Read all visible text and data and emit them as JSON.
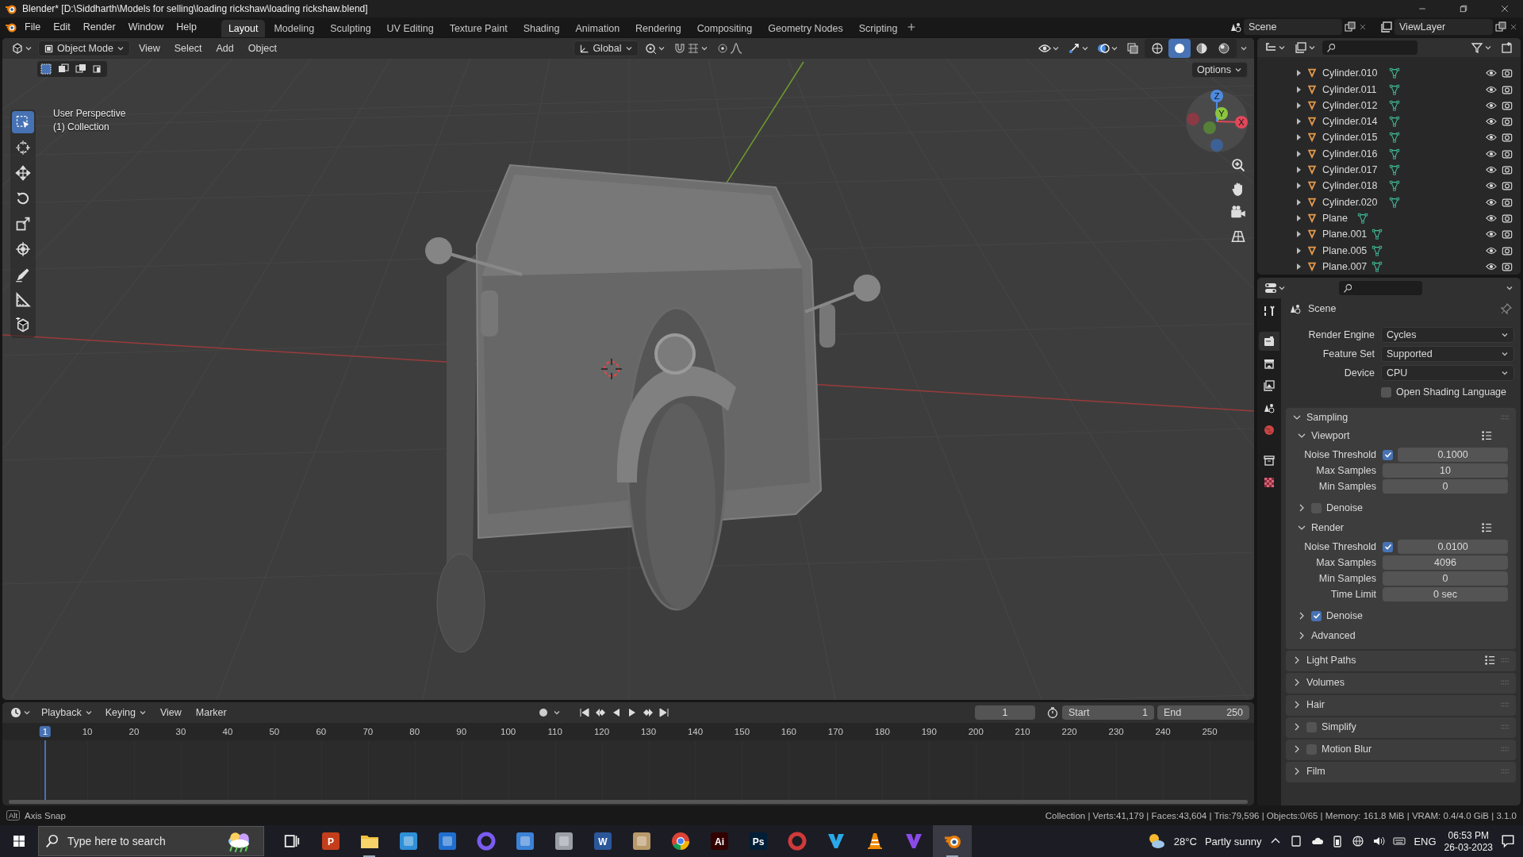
{
  "window": {
    "title": "Blender* [D:\\Siddharth\\Models for selling\\loading rickshaw\\loading rickshaw.blend]"
  },
  "menus": [
    "File",
    "Edit",
    "Render",
    "Window",
    "Help"
  ],
  "workspaces": [
    {
      "label": "Layout",
      "selected": true
    },
    {
      "label": "Modeling",
      "selected": false
    },
    {
      "label": "Sculpting",
      "selected": false
    },
    {
      "label": "UV Editing",
      "selected": false
    },
    {
      "label": "Texture Paint",
      "selected": false
    },
    {
      "label": "Shading",
      "selected": false
    },
    {
      "label": "Animation",
      "selected": false
    },
    {
      "label": "Rendering",
      "selected": false
    },
    {
      "label": "Compositing",
      "selected": false
    },
    {
      "label": "Geometry Nodes",
      "selected": false
    },
    {
      "label": "Scripting",
      "selected": false
    }
  ],
  "scene": "Scene",
  "view_layer": "ViewLayer",
  "viewport": {
    "mode": "Object Mode",
    "menus": [
      "View",
      "Select",
      "Add",
      "Object"
    ],
    "orientation": "Global",
    "options": "Options",
    "info": [
      "User Perspective",
      "(1) Collection"
    ],
    "tools": [
      {
        "kind": "select",
        "selected": true
      },
      {
        "kind": "cursor",
        "selected": false
      },
      {
        "kind": "move",
        "selected": false
      },
      {
        "kind": "rotate",
        "selected": false
      },
      {
        "kind": "scale",
        "selected": false
      },
      {
        "kind": "transform",
        "selected": false
      },
      {
        "kind": "annotate",
        "selected": false
      },
      {
        "kind": "measure",
        "selected": false
      },
      {
        "kind": "add-cube",
        "selected": false
      }
    ],
    "shading": [
      {
        "kind": "wireframe",
        "selected": false
      },
      {
        "kind": "solid",
        "selected": true
      },
      {
        "kind": "material",
        "selected": false
      },
      {
        "kind": "rendered",
        "selected": false
      }
    ],
    "gizmo": {
      "x": "X",
      "y": "Y",
      "z": "Z"
    }
  },
  "outliner": {
    "items": [
      {
        "name": "Cylinder.010"
      },
      {
        "name": "Cylinder.011"
      },
      {
        "name": "Cylinder.012"
      },
      {
        "name": "Cylinder.014"
      },
      {
        "name": "Cylinder.015"
      },
      {
        "name": "Cylinder.016"
      },
      {
        "name": "Cylinder.017"
      },
      {
        "name": "Cylinder.018"
      },
      {
        "name": "Cylinder.020"
      },
      {
        "name": "Plane"
      },
      {
        "name": "Plane.001"
      },
      {
        "name": "Plane.005"
      },
      {
        "name": "Plane.007"
      }
    ]
  },
  "properties": {
    "tabs": [
      {
        "kind": "tool",
        "selected": false
      },
      {
        "kind": "render",
        "selected": true
      },
      {
        "kind": "output",
        "selected": false
      },
      {
        "kind": "view-layer",
        "selected": false
      },
      {
        "kind": "scene",
        "selected": false
      },
      {
        "kind": "world",
        "selected": false
      },
      {
        "kind": "collection",
        "selected": false
      },
      {
        "kind": "texture",
        "selected": false
      }
    ],
    "context": "Scene",
    "fields": [
      {
        "label": "Render Engine",
        "value": "Cycles"
      },
      {
        "label": "Feature Set",
        "value": "Supported"
      },
      {
        "label": "Device",
        "value": "CPU"
      }
    ],
    "osl": {
      "label": "Open Shading Language",
      "checked": false
    },
    "sampling": {
      "title": "Sampling",
      "expanded": true,
      "subpanels": [
        {
          "title": "Viewport",
          "expanded": true,
          "noise": {
            "label": "Noise Threshold",
            "checked": true,
            "value": "0.1000"
          },
          "rows": [
            {
              "label": "Max Samples",
              "value": "10"
            },
            {
              "label": "Min Samples",
              "value": "0"
            }
          ],
          "denoise": {
            "label": "Denoise",
            "checked": false
          }
        },
        {
          "title": "Render",
          "expanded": true,
          "noise": {
            "label": "Noise Threshold",
            "checked": true,
            "value": "0.0100"
          },
          "rows": [
            {
              "label": "Max Samples",
              "value": "4096"
            },
            {
              "label": "Min Samples",
              "value": "0"
            },
            {
              "label": "Time Limit",
              "value": "0 sec"
            }
          ],
          "denoise": {
            "label": "Denoise",
            "checked": true
          }
        }
      ],
      "advanced": "Advanced"
    },
    "panels": [
      {
        "title": "Light Paths",
        "kind": "presets",
        "expanded": false
      },
      {
        "title": "Volumes",
        "kind": "plain",
        "expanded": false
      },
      {
        "title": "Hair",
        "kind": "plain",
        "expanded": false
      },
      {
        "title": "Simplify",
        "kind": "toggle",
        "checked": false,
        "expanded": false
      },
      {
        "title": "Motion Blur",
        "kind": "toggle",
        "checked": false,
        "expanded": false
      },
      {
        "title": "Film",
        "kind": "plain",
        "expanded": false
      }
    ]
  },
  "timeline": {
    "menus": [
      {
        "label": "Playback",
        "kind": "dropdown"
      },
      {
        "label": "Keying",
        "kind": "dropdown"
      },
      {
        "label": "View",
        "kind": "menu"
      },
      {
        "label": "Marker",
        "kind": "menu"
      }
    ],
    "current_frame": "1",
    "start_label": "Start",
    "start": "1",
    "end_label": "End",
    "end": "250",
    "ruler": [
      {
        "label": "1",
        "selected": true
      },
      {
        "label": "10",
        "selected": false
      },
      {
        "label": "20",
        "selected": false
      },
      {
        "label": "30",
        "selected": false
      },
      {
        "label": "40",
        "selected": false
      },
      {
        "label": "50",
        "selected": false
      },
      {
        "label": "60",
        "selected": false
      },
      {
        "label": "70",
        "selected": false
      },
      {
        "label": "80",
        "selected": false
      },
      {
        "label": "90",
        "selected": false
      },
      {
        "label": "100",
        "selected": false
      },
      {
        "label": "110",
        "selected": false
      },
      {
        "label": "120",
        "selected": false
      },
      {
        "label": "130",
        "selected": false
      },
      {
        "label": "140",
        "selected": false
      },
      {
        "label": "150",
        "selected": false
      },
      {
        "label": "160",
        "selected": false
      },
      {
        "label": "170",
        "selected": false
      },
      {
        "label": "180",
        "selected": false
      },
      {
        "label": "190",
        "selected": false
      },
      {
        "label": "200",
        "selected": false
      },
      {
        "label": "210",
        "selected": false
      },
      {
        "label": "220",
        "selected": false
      },
      {
        "label": "230",
        "selected": false
      },
      {
        "label": "240",
        "selected": false
      },
      {
        "label": "250",
        "selected": false
      }
    ]
  },
  "status_bar": {
    "key": "Alt",
    "hint": "Axis Snap",
    "stats": "Collection | Verts:41,179 | Faces:43,604 | Tris:79,596 | Objects:0/65 | Memory: 161.8 MiB | VRAM: 0.4/4.0 GiB | 3.1.0"
  },
  "taskbar": {
    "search_placeholder": "Type here to search",
    "apps": [
      {
        "kind": "task-view",
        "selected": false,
        "running": false
      },
      {
        "kind": "tile",
        "color": "#c43e1c",
        "label": "P",
        "selected": false,
        "running": false
      },
      {
        "kind": "folder",
        "selected": false,
        "running": true
      },
      {
        "kind": "tile",
        "color": "#2f8fd8",
        "selected": false,
        "running": false
      },
      {
        "kind": "tile",
        "color": "#1f6fd0",
        "selected": false,
        "running": false
      },
      {
        "kind": "ring",
        "color": "#7a5cf0",
        "selected": false,
        "running": false
      },
      {
        "kind": "tile",
        "color": "#3b82d6",
        "selected": false,
        "running": false
      },
      {
        "kind": "tile",
        "color": "#9aa0a6",
        "selected": false,
        "running": false
      },
      {
        "kind": "tile",
        "color": "#2b579a",
        "label": "W",
        "selected": false,
        "running": false
      },
      {
        "kind": "tile",
        "color": "#b89a6a",
        "selected": false,
        "running": false
      },
      {
        "kind": "chrome",
        "selected": false,
        "running": false
      },
      {
        "kind": "tile",
        "color": "#330000",
        "label": "Ai",
        "selected": false,
        "running": false
      },
      {
        "kind": "tile",
        "color": "#001e36",
        "label": "Ps",
        "selected": false,
        "running": false
      },
      {
        "kind": "ring",
        "color": "#d03a3a",
        "selected": false,
        "running": false
      },
      {
        "kind": "vee",
        "color": "#2aa8e8",
        "selected": false,
        "running": false
      },
      {
        "kind": "cone",
        "selected": false,
        "running": false
      },
      {
        "kind": "vee",
        "color": "#8a4be8",
        "selected": false,
        "running": false
      },
      {
        "kind": "blender",
        "selected": true,
        "running": true
      }
    ],
    "weather": {
      "temp": "28°C",
      "text": "Partly sunny"
    },
    "language": "ENG",
    "time": "06:53 PM",
    "date": "26-03-2023"
  }
}
